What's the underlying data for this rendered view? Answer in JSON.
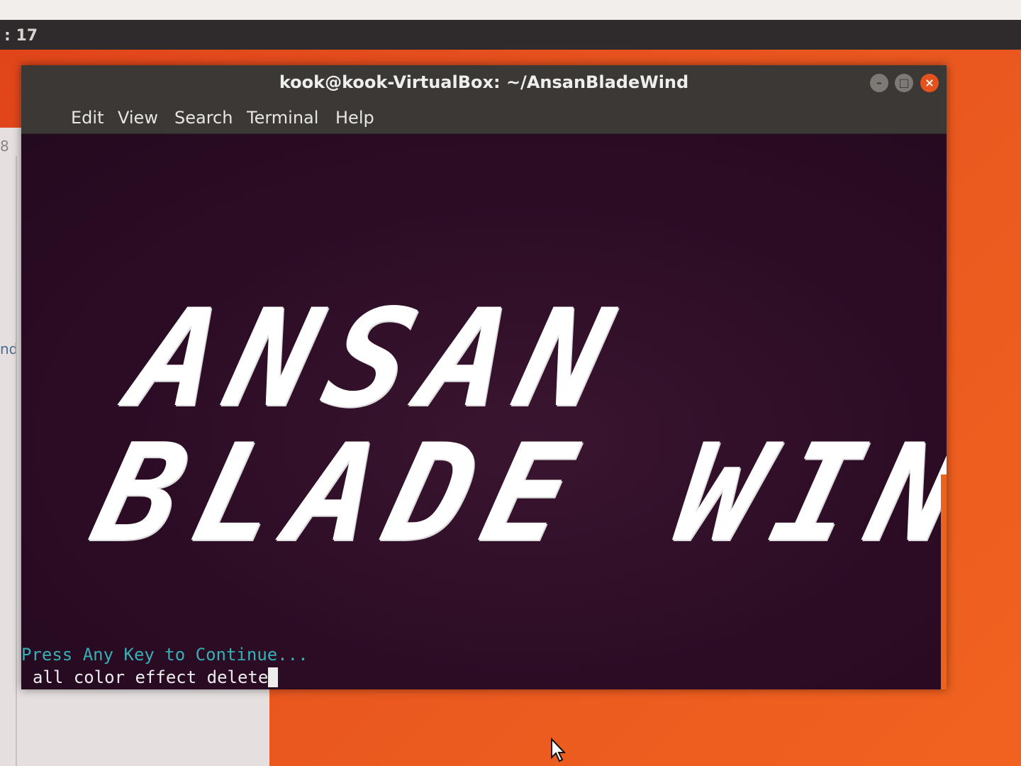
{
  "topbar": {
    "clock": ": 17"
  },
  "background_window": {
    "fragment_top": "8",
    "fragment_mid": "nd"
  },
  "terminal": {
    "title": "kook@kook-VirtualBox: ~/AnsanBladeWind",
    "menu": [
      "Edit",
      "View",
      "Search",
      "Terminal",
      "Help"
    ],
    "banner_line1": "ANSAN",
    "banner_line2": "BLADE WIND",
    "prompt_line1": "Press Any Key to Continue...",
    "prompt_line2": "all color effect delete",
    "colors": {
      "background": "#2c0c25",
      "prompt_accent": "#37b0b5",
      "close_button": "#e5521e"
    }
  },
  "icons": [
    "minimize-icon",
    "maximize-icon",
    "close-icon",
    "mouse-pointer-icon"
  ]
}
